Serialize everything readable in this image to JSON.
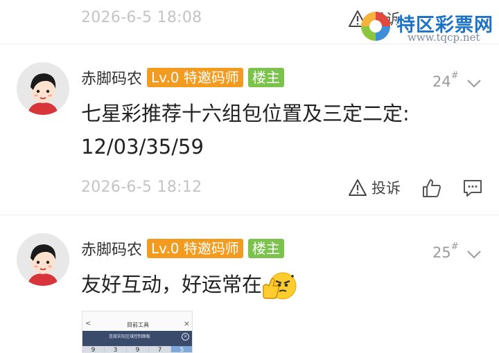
{
  "previous": {
    "time": "2026-6-5 18:08",
    "report_label": "投诉"
  },
  "watermark": {
    "title": "特区彩票网",
    "url": "www.tqcp.net"
  },
  "comments": [
    {
      "author": "赤脚码农",
      "level_badge": "Lv.0 特邀码师",
      "owner_badge": "楼主",
      "floor": "24",
      "floor_mark": "#",
      "content_line1": "七星彩推荐十六组包位置及三定二定:",
      "content_line2": "12/03/35/59",
      "time": "2026-6-5 18:12",
      "report_label": "投诉"
    },
    {
      "author": "赤脚码农",
      "level_badge": "Lv.0 特邀码师",
      "owner_badge": "楼主",
      "floor": "25",
      "floor_mark": "#",
      "content": "友好互动，好运常在"
    }
  ],
  "thumbnail": {
    "title": "目前工具",
    "back": "<",
    "close": "×",
    "prompt": "连接实际区域控制面板",
    "clear": "×",
    "digits": [
      "9",
      "3",
      "9",
      "7",
      "5"
    ]
  },
  "colors": {
    "level_badge": "#f29b1f",
    "owner_badge": "#7cc34d",
    "timestamp": "#c4c4c4",
    "divider": "#ececec",
    "watermark": "#1e73c8"
  },
  "icons": [
    "warning-icon",
    "thumbs-up-icon",
    "comment-icon",
    "chevron-down-icon",
    "avatar",
    "thumbs-up-emoji"
  ]
}
